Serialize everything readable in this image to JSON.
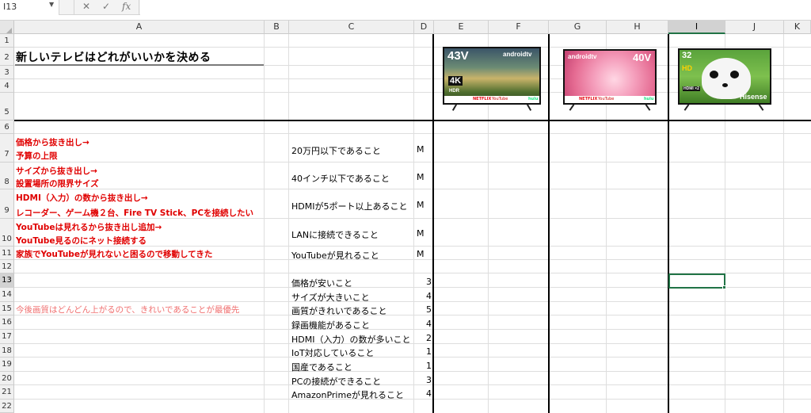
{
  "formula_bar": {
    "name_box": "I13",
    "cancel_icon": "✕",
    "enter_icon": "✓",
    "fx_icon": "fx",
    "formula": ""
  },
  "columns": [
    "A",
    "B",
    "C",
    "D",
    "E",
    "F",
    "G",
    "H",
    "I",
    "J",
    "K"
  ],
  "rows": [
    "1",
    "2",
    "3",
    "4",
    "5",
    "6",
    "7",
    "8",
    "9",
    "10",
    "11",
    "12",
    "13",
    "14",
    "15",
    "16",
    "17",
    "18",
    "19",
    "20",
    "21",
    "22"
  ],
  "selected_cell": {
    "column": "I",
    "row": "13"
  },
  "sheet": {
    "title": "新しいテレビはどれがいいかを決める",
    "reasons": [
      "価格から抜き出し→",
      "予算の上限",
      "サイズから抜き出し→",
      "設置場所の限界サイズ",
      "HDMI（入力）の数から抜き出し→",
      "レコーダー、ゲーム機２台、Fire TV Stick、PCを接続したい",
      "YouTubeは見れるから抜き出し追加→",
      "YouTube見るのにネット接続する",
      "家族でYouTubeが見れないと困るので移動してきた"
    ],
    "note15": "今後画質はどんどん上がるので、きれいであることが最優先",
    "must": [
      {
        "label": "20万円以下であること",
        "flag": "M"
      },
      {
        "label": "40インチ以下であること",
        "flag": "M"
      },
      {
        "label": "HDMIが5ポート以上あること",
        "flag": "M"
      },
      {
        "label": "LANに接続できること",
        "flag": "M"
      },
      {
        "label": "YouTubeが見れること",
        "flag": "M"
      }
    ],
    "wants": [
      {
        "label": "価格が安いこと",
        "weight": "3"
      },
      {
        "label": "サイズが大きいこと",
        "weight": "4"
      },
      {
        "label": "画質がきれいであること",
        "weight": "5"
      },
      {
        "label": "録画機能があること",
        "weight": "4"
      },
      {
        "label": "HDMI（入力）の数が多いこと",
        "weight": "2"
      },
      {
        "label": "IoT対応していること",
        "weight": "1"
      },
      {
        "label": "国産であること",
        "weight": "1"
      },
      {
        "label": "PCの接続ができること",
        "weight": "3"
      },
      {
        "label": "AmazonPrimeが見れること",
        "weight": "4"
      }
    ]
  },
  "tv_images": {
    "tv1": {
      "size": "43V",
      "brand": "androidtv",
      "badge": "4K",
      "badge2": "HDR",
      "apps": [
        "NETFLIX",
        "YouTube",
        "hulu"
      ]
    },
    "tv2": {
      "size": "40V",
      "brand": "androidtv",
      "apps": [
        "NETFLIX",
        "YouTube",
        "hulu"
      ]
    },
    "tv3": {
      "size": "32",
      "badge": "HD",
      "brand": "Hisense",
      "ports": "HDMI ×2"
    }
  },
  "colors": {
    "accent_green": "#217346",
    "red_text": "#e00000",
    "salmon_text": "#f07070"
  }
}
